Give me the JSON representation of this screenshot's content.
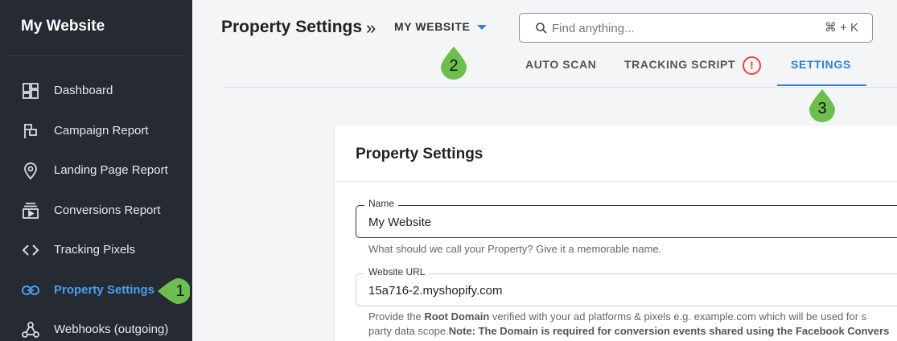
{
  "sidebar": {
    "brand": "My Website",
    "items": [
      {
        "label": "Dashboard",
        "icon": "dashboard-icon"
      },
      {
        "label": "Campaign Report",
        "icon": "flag-icon"
      },
      {
        "label": "Landing Page Report",
        "icon": "location-pin-icon"
      },
      {
        "label": "Conversions Report",
        "icon": "video-library-icon"
      },
      {
        "label": "Tracking Pixels",
        "icon": "code-brackets-icon"
      },
      {
        "label": "Property Settings",
        "icon": "link-icon",
        "active": true
      },
      {
        "label": "Webhooks (outgoing)",
        "icon": "webhook-icon"
      }
    ]
  },
  "header": {
    "title": "Property Settings",
    "separator": "»",
    "site_selector": "MY WEBSITE",
    "search": {
      "placeholder": "Find anything...",
      "shortcut": "⌘ + K"
    },
    "tabs": [
      {
        "label": "AUTO SCAN"
      },
      {
        "label": "TRACKING SCRIPT",
        "alert": "!"
      },
      {
        "label": "SETTINGS",
        "active": true
      }
    ]
  },
  "card": {
    "title": "Property Settings",
    "name_field": {
      "label": "Name",
      "value": "My Website",
      "helper": "What should we call your Property? Give it a memorable name."
    },
    "url_field": {
      "label": "Website URL",
      "value": "15a716-2.myshopify.com",
      "helper_1": "Provide the ",
      "helper_bold_1": "Root Domain",
      "helper_2": " verified with your ad platforms & pixels e.g. example.com which will be used for s",
      "helper_3": "party data scope.",
      "helper_bold_2": "Note: The Domain is required for conversion events shared using the Facebook Convers"
    }
  },
  "callouts": [
    "1",
    "2",
    "3"
  ],
  "colors": {
    "sidebar_bg": "#252a33",
    "accent": "#2f7fdc",
    "active_nav": "#4b9ff0",
    "callout": "#6cbf4f",
    "alert": "#e24a3b"
  }
}
